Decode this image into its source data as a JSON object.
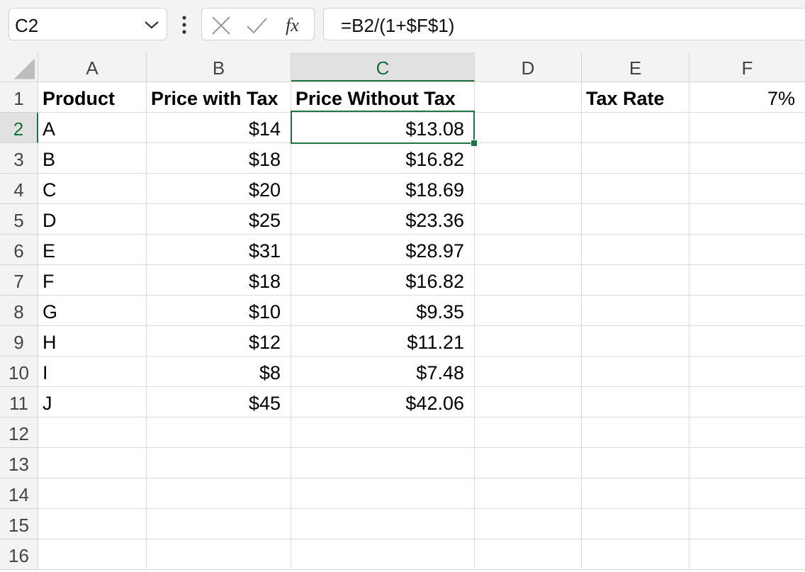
{
  "name_box": {
    "value": "C2"
  },
  "formula_bar": {
    "value": "=B2/(1+$F$1)"
  },
  "icons": {
    "cancel": "x-icon",
    "enter": "check-icon",
    "function": "fx-icon"
  },
  "fx_label": "fx",
  "accent_color": "#217346",
  "columns": [
    "A",
    "B",
    "C",
    "D",
    "E",
    "F"
  ],
  "selected_cell": "C2",
  "rows": [
    {
      "n": "1",
      "A": "Product",
      "B": "Price with Tax",
      "C": "Price Without Tax",
      "E": "Tax Rate",
      "F": "7%"
    },
    {
      "n": "2",
      "A": "A",
      "B": "$14",
      "C": "$13.08"
    },
    {
      "n": "3",
      "A": "B",
      "B": "$18",
      "C": "$16.82"
    },
    {
      "n": "4",
      "A": "C",
      "B": "$20",
      "C": "$18.69"
    },
    {
      "n": "5",
      "A": "D",
      "B": "$25",
      "C": "$23.36"
    },
    {
      "n": "6",
      "A": "E",
      "B": "$31",
      "C": "$28.97"
    },
    {
      "n": "7",
      "A": "F",
      "B": "$18",
      "C": "$16.82"
    },
    {
      "n": "8",
      "A": "G",
      "B": "$10",
      "C": "$9.35"
    },
    {
      "n": "9",
      "A": "H",
      "B": "$12",
      "C": "$11.21"
    },
    {
      "n": "10",
      "A": "I",
      "B": "$8",
      "C": "$7.48"
    },
    {
      "n": "11",
      "A": "J",
      "B": "$45",
      "C": "$42.06"
    },
    {
      "n": "12"
    },
    {
      "n": "13"
    },
    {
      "n": "14"
    },
    {
      "n": "15"
    },
    {
      "n": "16"
    }
  ]
}
